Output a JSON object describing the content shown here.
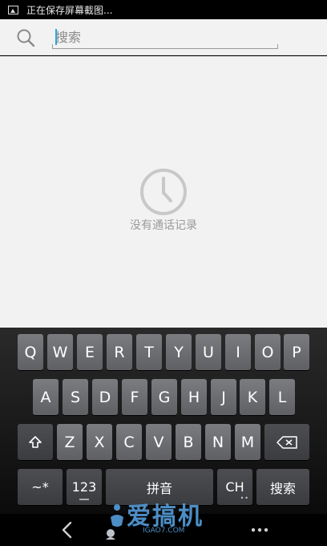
{
  "status_bar": {
    "text": "正在保存屏幕截图...",
    "icon": "image-icon"
  },
  "search": {
    "placeholder": "搜索",
    "value": "",
    "icon": "search-icon"
  },
  "empty_state": {
    "icon": "clock-icon",
    "text": "没有通话记录"
  },
  "keyboard": {
    "row1": [
      "Q",
      "W",
      "E",
      "R",
      "T",
      "Y",
      "U",
      "I",
      "O",
      "P"
    ],
    "row2": [
      "A",
      "S",
      "D",
      "F",
      "G",
      "H",
      "J",
      "K",
      "L"
    ],
    "row3": [
      "Z",
      "X",
      "C",
      "V",
      "B",
      "N",
      "M"
    ],
    "symbols_label": "~*",
    "numbers_label": "123",
    "space_label": "拼音",
    "lang_label": "CH",
    "search_label": "搜索"
  },
  "navigation": {
    "back_icon": "back-arrow-icon",
    "menu_icon": "more-dots-icon"
  },
  "watermark": {
    "text": "爱搞机",
    "subtext": "IGAO7.COM"
  },
  "colors": {
    "accent": "#2fa6d6",
    "watermark": "#5aa6e8",
    "key": "#6c6e72",
    "background": "#f2f2f2"
  }
}
